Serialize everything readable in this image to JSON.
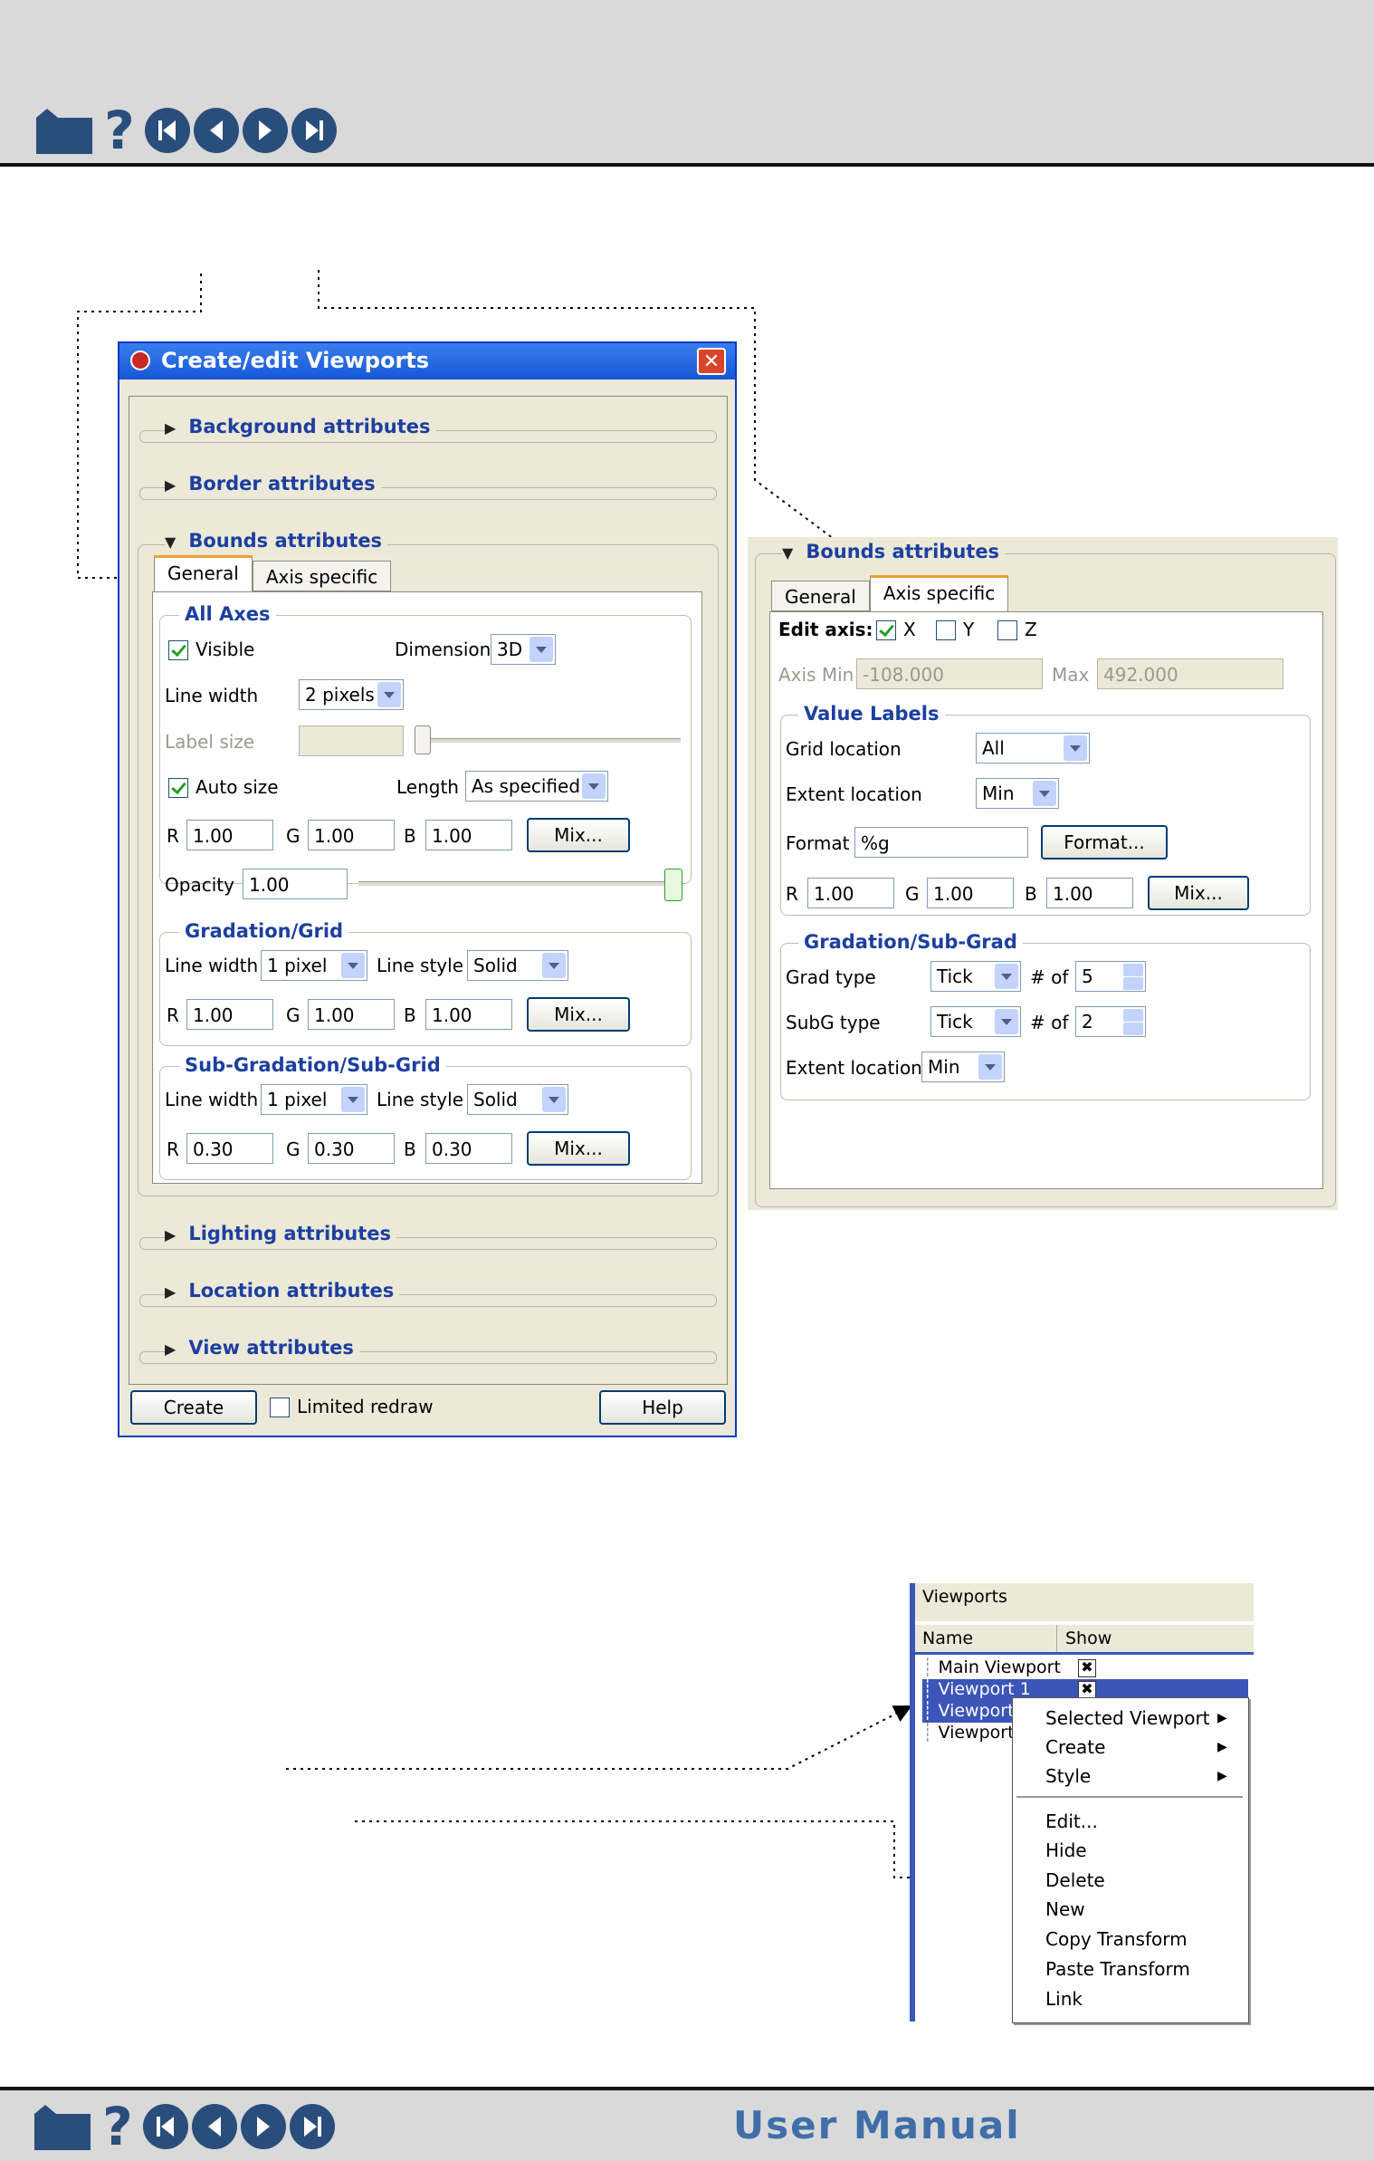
{
  "footer": {
    "title": "User Manual"
  },
  "icons": [
    "home-icon",
    "help-icon",
    "first-page-icon",
    "previous-page-icon",
    "next-page-icon",
    "last-page-icon"
  ],
  "dialog": {
    "title": "Create/edit Viewports",
    "sections": {
      "background": "Background attributes",
      "border": "Border attributes",
      "bounds": "Bounds attributes",
      "lighting": "Lighting attributes",
      "location": "Location attributes",
      "view": "View attributes"
    },
    "tabs": {
      "general": "General",
      "axis_specific": "Axis specific"
    },
    "all_axes": {
      "title": "All Axes",
      "visible_label": "Visible",
      "visible_checked": true,
      "dimension_label": "Dimension",
      "dimension_value": "3D",
      "line_width_label": "Line width",
      "line_width_value": "2 pixels",
      "label_size_label": "Label size",
      "auto_size_label": "Auto size",
      "auto_size_checked": true,
      "length_label": "Length",
      "length_value": "As specified",
      "r_label": "R",
      "r_value": "1.00",
      "g_label": "G",
      "g_value": "1.00",
      "b_label": "B",
      "b_value": "1.00",
      "mix_label": "Mix...",
      "opacity_label": "Opacity",
      "opacity_value": "1.00"
    },
    "gradation_grid": {
      "title": "Gradation/Grid",
      "line_width_label": "Line width",
      "line_width_value": "1 pixel",
      "line_style_label": "Line style",
      "line_style_value": "Solid",
      "r_label": "R",
      "r_value": "1.00",
      "g_label": "G",
      "g_value": "1.00",
      "b_label": "B",
      "b_value": "1.00",
      "mix_label": "Mix..."
    },
    "sub_gradation": {
      "title": "Sub-Gradation/Sub-Grid",
      "line_width_label": "Line width",
      "line_width_value": "1 pixel",
      "line_style_label": "Line style",
      "line_style_value": "Solid",
      "r_label": "R",
      "r_value": "0.30",
      "g_label": "G",
      "g_value": "0.30",
      "b_label": "B",
      "b_value": "0.30",
      "mix_label": "Mix..."
    },
    "footer": {
      "create_label": "Create",
      "limited_redraw_label": "Limited redraw",
      "limited_redraw_checked": false,
      "help_label": "Help"
    }
  },
  "axis_panel": {
    "section_title": "Bounds attributes",
    "tab_general": "General",
    "tab_axis_specific": "Axis specific",
    "edit_axis_label": "Edit axis:",
    "axis_x": "X",
    "axis_x_checked": true,
    "axis_y": "Y",
    "axis_y_checked": false,
    "axis_z": "Z",
    "axis_z_checked": false,
    "axis_min_label": "Axis Min",
    "axis_min_value": "-108.000",
    "max_label": "Max",
    "max_value": "492.000",
    "value_labels": {
      "title": "Value Labels",
      "grid_location_label": "Grid location",
      "grid_location_value": "All",
      "extent_location_label": "Extent location",
      "extent_location_value": "Min",
      "format_label": "Format",
      "format_value": "%g",
      "format_button": "Format...",
      "r_label": "R",
      "r_value": "1.00",
      "g_label": "G",
      "g_value": "1.00",
      "b_label": "B",
      "b_value": "1.00",
      "mix_label": "Mix..."
    },
    "gradation_subgrad": {
      "title": "Gradation/Sub-Grad",
      "grad_type_label": "Grad type",
      "grad_type_value": "Tick",
      "grad_of_label": "# of",
      "grad_count": "5",
      "subg_type_label": "SubG type",
      "subg_type_value": "Tick",
      "subg_of_label": "# of",
      "subg_count": "2",
      "extent_location_label": "Extent location",
      "extent_location_value": "Min"
    }
  },
  "viewports": {
    "title": "Viewports",
    "col_name": "Name",
    "col_show": "Show",
    "rows": [
      "Main Viewport",
      "Viewport 1",
      "Viewport",
      "Viewport"
    ],
    "context_menu": {
      "selected_viewport": "Selected Viewport",
      "create": "Create",
      "style": "Style",
      "edit": "Edit...",
      "hide": "Hide",
      "delete": "Delete",
      "new": "New",
      "copy_transform": "Copy Transform",
      "paste_transform": "Paste Transform",
      "link": "Link"
    }
  },
  "colors": {
    "accent": "#1c3fa0",
    "title_bar": "#1657d6",
    "selection": "#3b55b8",
    "nav": "#2a4e7c"
  }
}
